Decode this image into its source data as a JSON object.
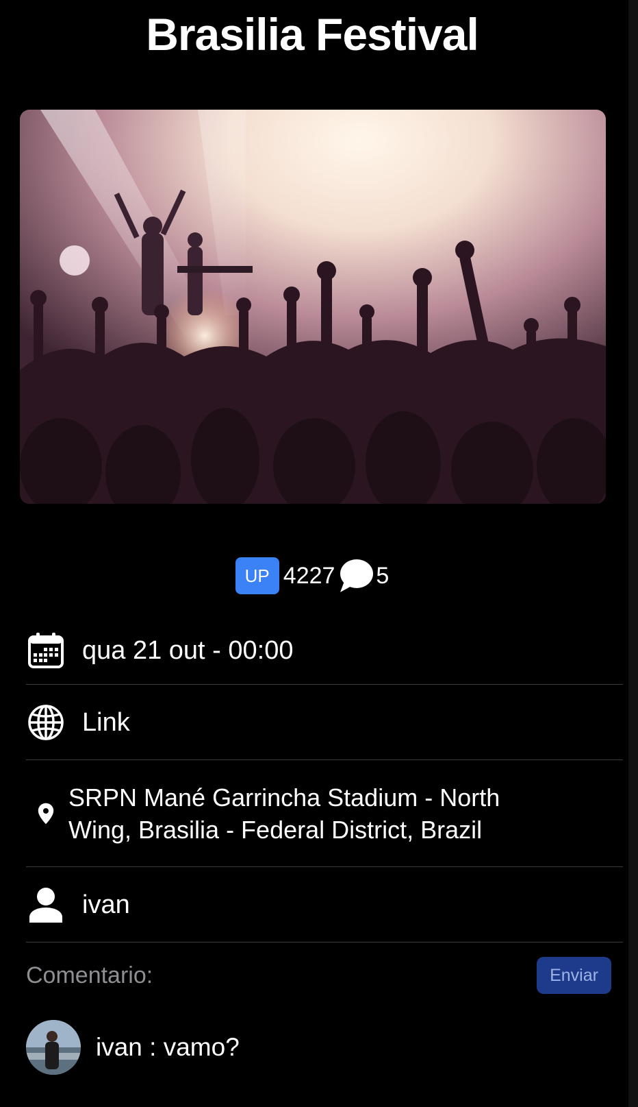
{
  "event": {
    "title": "Brasilia Festival",
    "image_alt": "Concert crowd with raised hands in front of a lit stage"
  },
  "stats": {
    "up_label": "UP",
    "up_count": "4227",
    "comment_count": "5"
  },
  "details": {
    "date": "qua 21 out - 00:00",
    "link": "Link",
    "location": "SRPN Mané Garrincha Stadium - North Wing, Brasilia - Federal District, Brazil",
    "organizer": "ivan"
  },
  "comment_form": {
    "placeholder": "Comentario:",
    "send_label": "Enviar"
  },
  "comments": [
    {
      "text": "ivan : vamo?"
    }
  ],
  "colors": {
    "background": "#000000",
    "accent": "#3b82f6",
    "send_button": "#1e3a8a",
    "divider": "#3c3c3c",
    "placeholder": "#8e8e93"
  },
  "icons": {
    "date": "calendar-icon",
    "link": "globe-icon",
    "location": "map-pin-icon",
    "organizer": "person-icon",
    "comments": "speech-bubble-icon"
  }
}
